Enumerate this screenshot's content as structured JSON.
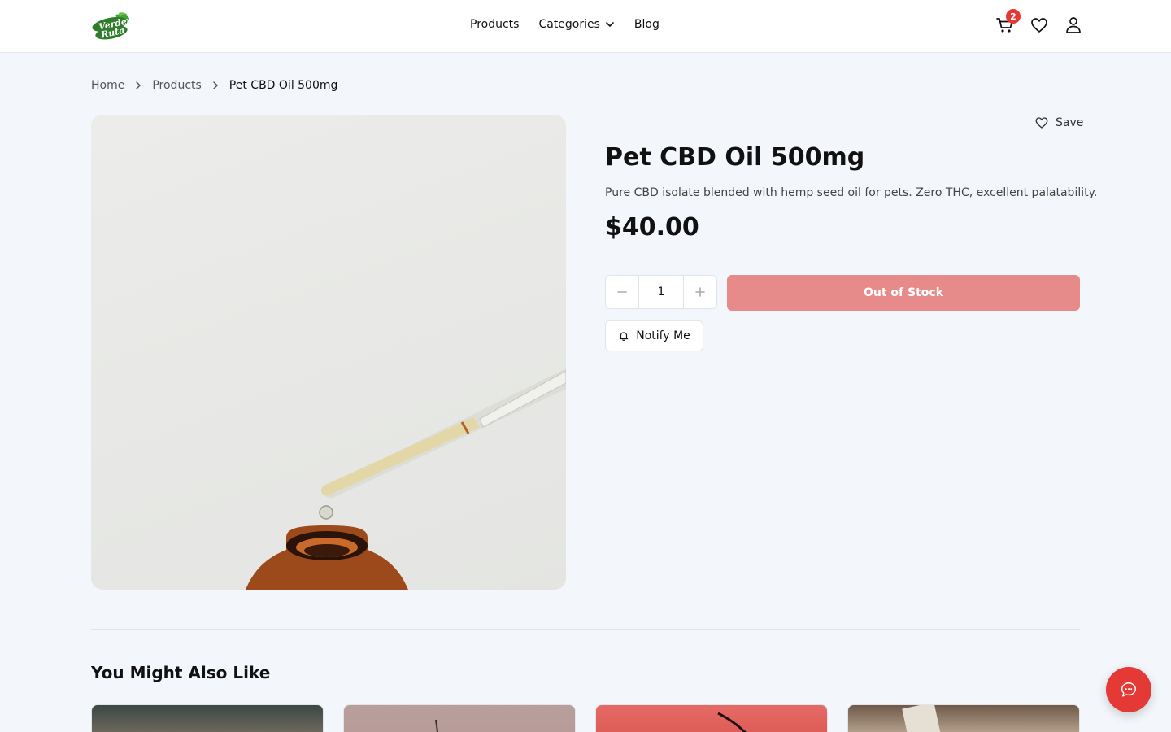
{
  "brand": {
    "logo_text": "Verde Ruta",
    "accent": "#e53935",
    "green": "#3a8a2e"
  },
  "nav": {
    "products": "Products",
    "categories": "Categories",
    "blog": "Blog"
  },
  "header": {
    "cart_count": "2",
    "icons": [
      "cart-icon",
      "heart-icon",
      "user-icon"
    ]
  },
  "breadcrumb": {
    "home": "Home",
    "products": "Products",
    "current": "Pet CBD Oil 500mg"
  },
  "product": {
    "save_label": "Save",
    "title": "Pet CBD Oil 500mg",
    "description": "Pure CBD isolate blended with hemp seed oil for pets. Zero THC, excellent palatability.",
    "price": "$40.00",
    "quantity": "1",
    "stock_button": "Out of Stock",
    "notify_label": "Notify Me"
  },
  "related": {
    "title": "You Might Also Like"
  }
}
